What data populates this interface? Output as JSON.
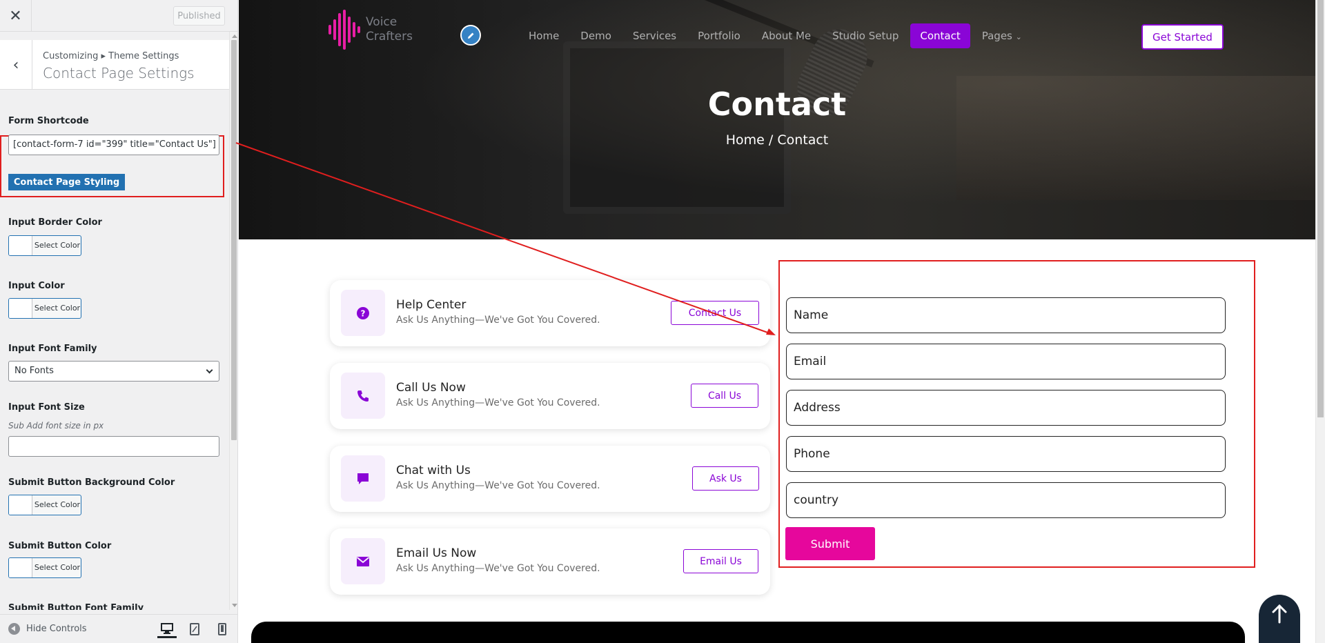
{
  "customizer": {
    "close_icon": "x-icon",
    "published_label": "Published",
    "breadcrumb": "Customizing ▸ Theme Settings",
    "section_title": "Contact Page Settings",
    "form_shortcode": {
      "label": "Form Shortcode",
      "value": "[contact-form-7 id=\"399\" title=\"Contact Us\"]"
    },
    "styling_button": "Contact Page Styling",
    "input_border_color": {
      "label": "Input Border Color",
      "button": "Select Color"
    },
    "input_color": {
      "label": "Input Color",
      "button": "Select Color"
    },
    "input_font_family": {
      "label": "Input Font Family",
      "selected": "No Fonts"
    },
    "input_font_size": {
      "label": "Input Font Size",
      "description": "Sub Add font size in px",
      "value": ""
    },
    "submit_bg_color": {
      "label": "Submit Button Background Color",
      "button": "Select Color"
    },
    "submit_color": {
      "label": "Submit Button Color",
      "button": "Select Color"
    },
    "submit_font_family": {
      "label": "Submit Button Font Family"
    },
    "footer": {
      "hide_controls": "Hide Controls",
      "devices": [
        "desktop-icon",
        "tablet-icon",
        "mobile-icon"
      ]
    }
  },
  "site": {
    "logo": {
      "line1": "Voice",
      "line2": "Crafters"
    },
    "nav": [
      "Home",
      "Demo",
      "Services",
      "Portfolio",
      "About Me",
      "Studio Setup",
      "Contact",
      "Pages"
    ],
    "active_nav": "Contact",
    "cta": "Get Started",
    "hero_title": "Contact",
    "hero_breadcrumb": "Home / Contact",
    "cards": [
      {
        "title": "Help Center",
        "desc": "Ask Us Anything—We've Got You Covered.",
        "button": "Contact Us",
        "icon": "question-icon"
      },
      {
        "title": "Call Us Now",
        "desc": "Ask Us Anything—We've Got You Covered.",
        "button": "Call Us",
        "icon": "phone-icon"
      },
      {
        "title": "Chat with Us",
        "desc": "Ask Us Anything—We've Got You Covered.",
        "button": "Ask Us",
        "icon": "chat-icon"
      },
      {
        "title": "Email Us Now",
        "desc": "Ask Us Anything—We've Got You Covered.",
        "button": "Email Us",
        "icon": "envelope-icon"
      }
    ],
    "form": {
      "placeholders": [
        "Name",
        "Email",
        "Address",
        "Phone",
        "country"
      ],
      "submit": "Submit"
    }
  },
  "colors": {
    "accent": "#8a05d6",
    "submit_pink": "#e6079c",
    "wp_blue": "#2271b1",
    "annotation_red": "#e01e1e"
  }
}
